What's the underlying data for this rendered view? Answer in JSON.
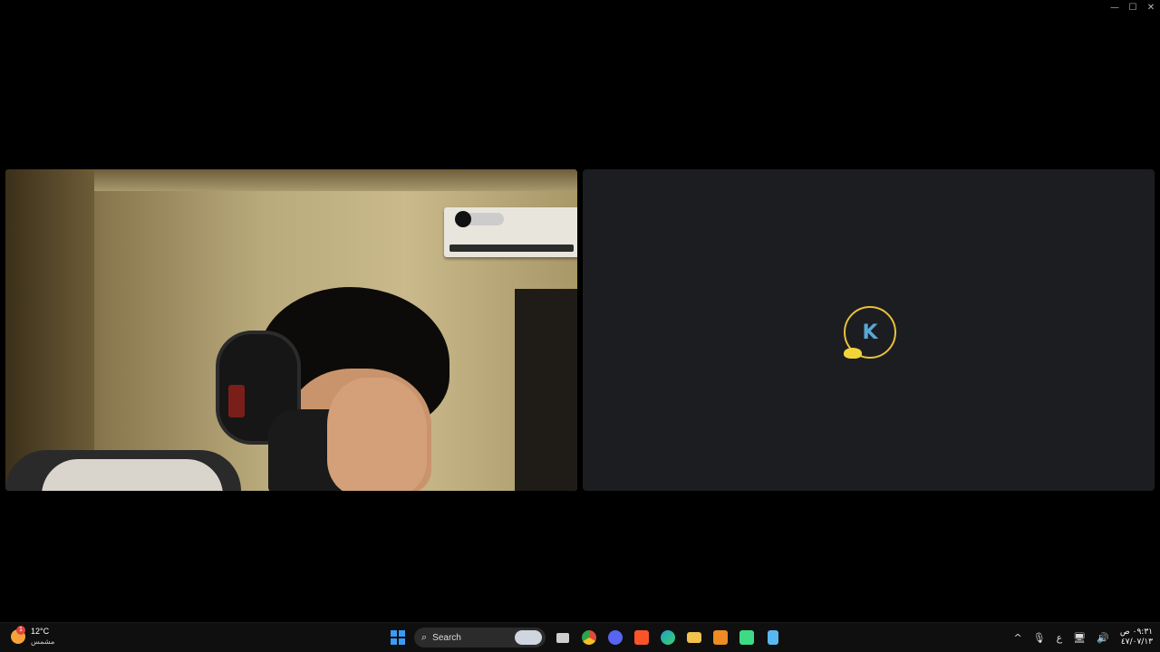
{
  "window": {
    "minimize_glyph": "—",
    "maximize_glyph": "☐",
    "close_glyph": "✕"
  },
  "tiles": {
    "camera_participant": {},
    "avatar_participant": {
      "avatar_letter": "K",
      "ring_color": "#e8c13a",
      "letter_color": "#5aa6d8"
    }
  },
  "taskbar": {
    "weather": {
      "badge": "1",
      "temperature": "12°C",
      "condition": "مشمس"
    },
    "search": {
      "label": "Search",
      "icon": "search-icon"
    },
    "apps": [
      {
        "name": "start",
        "icon": "windows-start-icon"
      },
      {
        "name": "task-view",
        "icon": "task-view-icon"
      },
      {
        "name": "chrome",
        "icon": "chrome-icon",
        "color": "#e24a3b"
      },
      {
        "name": "discord",
        "icon": "discord-icon",
        "color": "#5865f2"
      },
      {
        "name": "brave",
        "icon": "brave-icon",
        "color": "#fb542b"
      },
      {
        "name": "edge",
        "icon": "edge-icon",
        "color": "#1fa1c9"
      },
      {
        "name": "file-explorer",
        "icon": "folder-icon",
        "color": "#f2c14e"
      },
      {
        "name": "app-orange",
        "icon": "orange-a-icon",
        "color": "#f08a24"
      },
      {
        "name": "app-green",
        "icon": "green-app-icon",
        "color": "#3ddc84"
      },
      {
        "name": "notepad",
        "icon": "notepad-icon",
        "color": "#5ab8f0"
      }
    ],
    "tray": {
      "overflow_glyph": "^",
      "mic_glyph": "🎙",
      "language": "ع",
      "network_glyph": "🖥",
      "volume_glyph": "🔊",
      "time": "٠٩:٣١ ص",
      "date": "٤٧/٠٧/١٣"
    }
  }
}
